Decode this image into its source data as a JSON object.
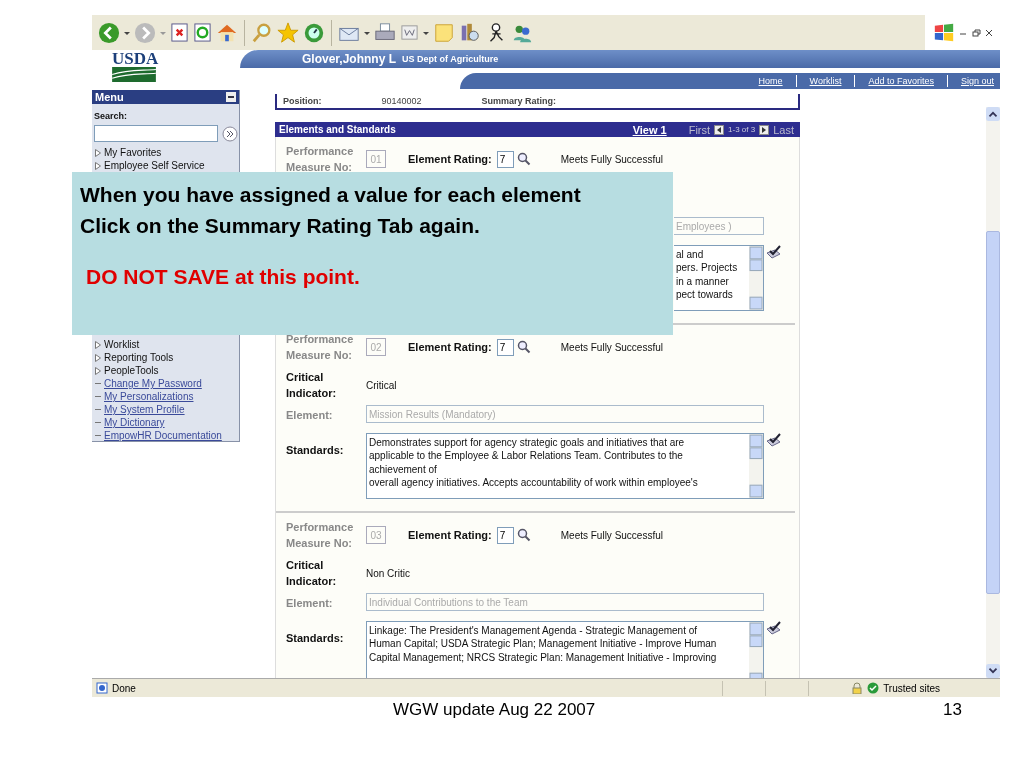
{
  "header": {
    "logo": "USDA",
    "user": "Glover,Johnny L",
    "org": "US Dept of Agriculture",
    "links": [
      {
        "label": "Home"
      },
      {
        "label": "Worklist"
      },
      {
        "label": "Add to Favorites"
      },
      {
        "label": "Sign out"
      }
    ]
  },
  "menu": {
    "title": "Menu",
    "search_label": "Search:",
    "items_top": [
      {
        "label": "My Favorites",
        "kind": "folder"
      },
      {
        "label": "Employee Self Service",
        "kind": "folder"
      }
    ],
    "items_bottom": [
      {
        "label": "Worklist",
        "kind": "folder"
      },
      {
        "label": "Reporting Tools",
        "kind": "folder"
      },
      {
        "label": "PeopleTools",
        "kind": "folder"
      },
      {
        "label": "Change My Password",
        "kind": "link"
      },
      {
        "label": "My Personalizations",
        "kind": "link"
      },
      {
        "label": "My System Profile",
        "kind": "link"
      },
      {
        "label": "My Dictionary",
        "kind": "link"
      },
      {
        "label": "EmpowHR Documentation",
        "kind": "link"
      }
    ]
  },
  "position": {
    "label": "Position:",
    "value": "90140002",
    "rating_label": "Summary Rating:"
  },
  "elements": {
    "title": "Elements and Standards",
    "view": "View 1",
    "first": "First",
    "range": "1-3 of 3",
    "last": "Last",
    "sections": [
      {
        "measure_label": "Performance Measure No:",
        "measure": "01",
        "rating_label": "Element Rating:",
        "rating": "7",
        "rating_text": "Meets Fully Successful",
        "element": "Employees )",
        "standards": "al and\npers. Projects\nin a manner\npect towards",
        "partial": true
      },
      {
        "measure_label": "Performance Measure No:",
        "measure": "02",
        "rating_label": "Element Rating:",
        "rating": "7",
        "rating_text": "Meets Fully Successful",
        "critical_label": "Critical Indicator:",
        "critical": "Critical",
        "element_label": "Element:",
        "element": "Mission Results (Mandatory)",
        "standards_label": "Standards:",
        "standards": "Demonstrates support for agency strategic goals and initiatives that are\napplicable to the Employee & Labor Relations Team.  Contributes to the\nachievement of\noverall agency initiatives.  Accepts accountability of work within employee's",
        "partial": false
      },
      {
        "measure_label": "Performance Measure No:",
        "measure": "03",
        "rating_label": "Element Rating:",
        "rating": "7",
        "rating_text": "Meets Fully Successful",
        "critical_label": "Critical Indicator:",
        "critical": "Non Critic",
        "element_label": "Element:",
        "element": "Individual Contributions to the Team",
        "standards_label": "Standards:",
        "standards": "Linkage:  The President's Management Agenda - Strategic Management of\nHuman Capital; USDA Strategic Plan; Management Initiative - Improve Human\nCapital Management; NRCS Strategic Plan:  Management Initiative - Improving",
        "partial": false
      }
    ]
  },
  "status_bar": {
    "text": "Done",
    "zone": "Trusted sites"
  },
  "callout": {
    "text": "When you have assigned a value for each element Click on the Summary Rating Tab again.",
    "warning": "DO NOT SAVE at this point."
  },
  "footer": {
    "caption": "WGW update Aug 22 2007",
    "page": "13"
  }
}
